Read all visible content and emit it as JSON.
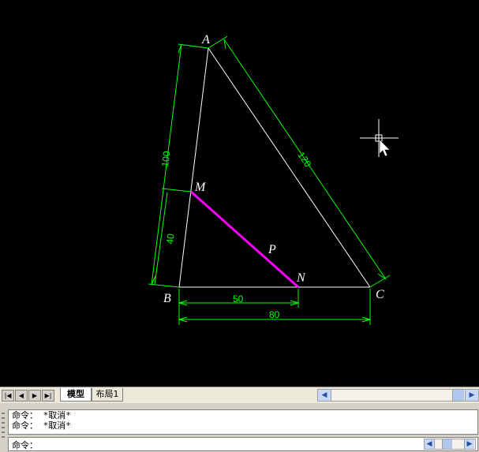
{
  "drawing": {
    "points": {
      "A": "A",
      "B": "B",
      "C": "C",
      "M": "M",
      "N": "N",
      "P": "P"
    },
    "dimensions": {
      "ab": "100",
      "ac": "120",
      "bm": "40",
      "bn": "50",
      "bc": "80"
    },
    "colors": {
      "background": "#000000",
      "dimension": "#00ff00",
      "geometry": "#ffffff",
      "segment_mn": "#ff00ff"
    }
  },
  "tabbar": {
    "nav": [
      "first-icon",
      "prev-icon",
      "next-icon",
      "last-icon"
    ],
    "tabs": [
      {
        "label": "模型",
        "active": true
      },
      {
        "label": "布局1",
        "active": false
      }
    ]
  },
  "command": {
    "history": [
      "命令： *取消*",
      "命令： *取消*"
    ],
    "prompt": "命令："
  }
}
